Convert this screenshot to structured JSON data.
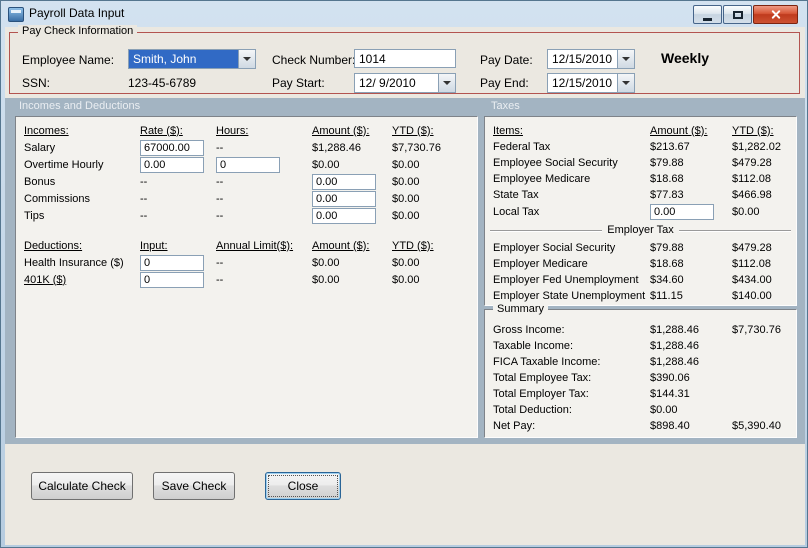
{
  "window": {
    "title": "Payroll Data Input"
  },
  "colors": {
    "section_band": "#a3b4c2",
    "selection_blue": "#316ac5",
    "group_border_red": "#b35450"
  },
  "paycheck": {
    "group_title": "Pay Check Information",
    "fields": {
      "employee_name": {
        "label": "Employee Name:",
        "value": "Smith, John"
      },
      "ssn": {
        "label": "SSN:",
        "value": "123-45-6789"
      },
      "check_number": {
        "label": "Check Number:",
        "value": "1014"
      },
      "pay_start": {
        "label": "Pay Start:",
        "value": "12/ 9/2010"
      },
      "pay_date": {
        "label": "Pay Date:",
        "value": "12/15/2010"
      },
      "pay_end": {
        "label": "Pay End:",
        "value": "12/15/2010"
      },
      "frequency": "Weekly"
    }
  },
  "sections": {
    "incomes_deductions": "Incomes and Deductions",
    "taxes": "Taxes"
  },
  "incomes": {
    "headers": {
      "name": "Incomes:",
      "rate": "Rate ($):",
      "hours": "Hours:",
      "amount": "Amount ($):",
      "ytd": "YTD ($):"
    },
    "rows": [
      {
        "name": "Salary",
        "rate": "67000.00",
        "hours": "--",
        "amount": "$1,288.46",
        "ytd": "$7,730.76"
      },
      {
        "name": "Overtime Hourly",
        "rate": "0.00",
        "hours": "0",
        "amount": "$0.00",
        "ytd": "$0.00"
      },
      {
        "name": "Bonus",
        "rate": "--",
        "hours": "--",
        "amount": "0.00",
        "ytd": "$0.00"
      },
      {
        "name": "Commissions",
        "rate": "--",
        "hours": "--",
        "amount": "0.00",
        "ytd": "$0.00"
      },
      {
        "name": "Tips",
        "rate": "--",
        "hours": "--",
        "amount": "0.00",
        "ytd": "$0.00"
      }
    ]
  },
  "deductions": {
    "headers": {
      "name": "Deductions:",
      "input": "Input:",
      "limit": "Annual Limit($):",
      "amount": "Amount ($):",
      "ytd": "YTD ($):"
    },
    "rows": [
      {
        "name": "Health Insurance ($)",
        "input": "0",
        "limit": "--",
        "amount": "$0.00",
        "ytd": "$0.00"
      },
      {
        "name": "401K ($)",
        "input": "0",
        "limit": "--",
        "amount": "$0.00",
        "ytd": "$0.00"
      }
    ]
  },
  "taxes": {
    "headers": {
      "name": "Items:",
      "amount": "Amount ($):",
      "ytd": "YTD ($):"
    },
    "employee_rows": [
      {
        "name": "Federal Tax",
        "amount": "$213.67",
        "ytd": "$1,282.02"
      },
      {
        "name": "Employee Social Security",
        "amount": "$79.88",
        "ytd": "$479.28"
      },
      {
        "name": "Employee Medicare",
        "amount": "$18.68",
        "ytd": "$112.08"
      },
      {
        "name": "State Tax",
        "amount": "$77.83",
        "ytd": "$466.98"
      },
      {
        "name": "Local Tax",
        "amount": "0.00",
        "ytd": "$0.00"
      }
    ],
    "employer_divider": "Employer Tax",
    "employer_rows": [
      {
        "name": "Employer Social Security",
        "amount": "$79.88",
        "ytd": "$479.28"
      },
      {
        "name": "Employer Medicare",
        "amount": "$18.68",
        "ytd": "$112.08"
      },
      {
        "name": "Employer Fed Unemployment",
        "amount": "$34.60",
        "ytd": "$434.00"
      },
      {
        "name": "Employer State Unemployment",
        "amount": "$11.15",
        "ytd": "$140.00"
      }
    ]
  },
  "summary": {
    "group_title": "Summary",
    "rows": [
      {
        "label": "Gross Income:",
        "amount": "$1,288.46",
        "ytd": "$7,730.76"
      },
      {
        "label": "Taxable Income:",
        "amount": "$1,288.46",
        "ytd": ""
      },
      {
        "label": "FICA Taxable Income:",
        "amount": "$1,288.46",
        "ytd": ""
      },
      {
        "label": "Total Employee Tax:",
        "amount": "$390.06",
        "ytd": ""
      },
      {
        "label": "Total Employer Tax:",
        "amount": "$144.31",
        "ytd": ""
      },
      {
        "label": "Total Deduction:",
        "amount": "$0.00",
        "ytd": ""
      },
      {
        "label": "Net Pay:",
        "amount": "$898.40",
        "ytd": "$5,390.40"
      }
    ]
  },
  "buttons": {
    "calculate": "Calculate Check",
    "save": "Save Check",
    "close": "Close"
  }
}
